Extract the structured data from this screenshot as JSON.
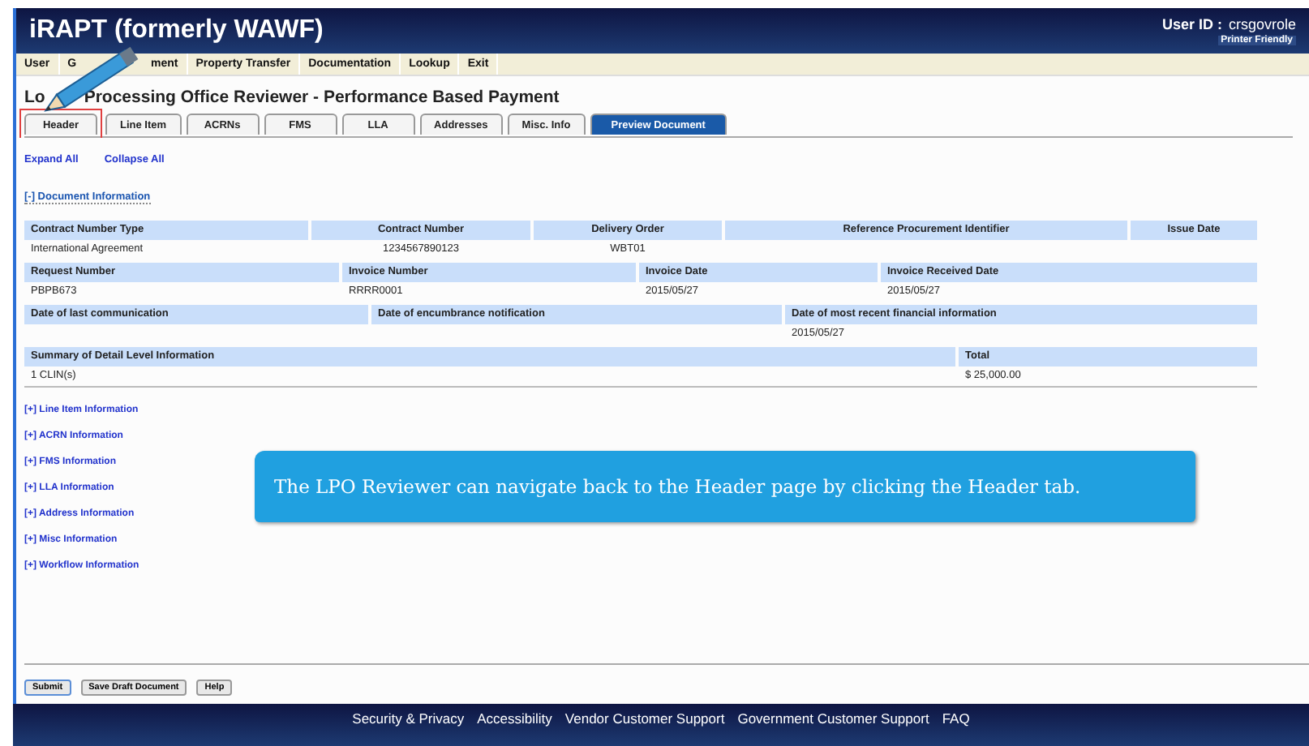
{
  "app": {
    "title": "iRAPT (formerly WAWF)",
    "user_label": "User ID :",
    "user_id": "crsgovrole",
    "printer_link": "Printer Friendly"
  },
  "menu": [
    {
      "parts": [
        "User"
      ]
    },
    {
      "parts": [
        "G",
        "ment"
      ]
    },
    {
      "parts": [
        "Property Transfer"
      ]
    },
    {
      "parts": [
        "Documentation"
      ]
    },
    {
      "parts": [
        "Lookup"
      ]
    },
    {
      "parts": [
        "Exit"
      ]
    }
  ],
  "page_title": [
    "Lo",
    "Processing Office Reviewer - Performance Based Payment"
  ],
  "tabs": [
    {
      "label": "Header",
      "selected": false,
      "highlighted": true
    },
    {
      "label": "Line Item",
      "selected": false,
      "highlighted": false
    },
    {
      "label": "ACRNs",
      "selected": false,
      "highlighted": false
    },
    {
      "label": "FMS",
      "selected": false,
      "highlighted": false
    },
    {
      "label": "LLA",
      "selected": false,
      "highlighted": false
    },
    {
      "label": "Addresses",
      "selected": false,
      "highlighted": false
    },
    {
      "label": "Misc. Info",
      "selected": false,
      "highlighted": false
    },
    {
      "label": "Preview Document",
      "selected": true,
      "highlighted": false
    }
  ],
  "expand_links": [
    "Expand All",
    "Collapse All"
  ],
  "document_section": "[-] Document Information",
  "info_rows": [
    {
      "columns": [
        {
          "label": "Contract Number Type",
          "value": "International Agreement"
        },
        {
          "label": "Contract Number",
          "value": "1234567890123"
        },
        {
          "label": "Delivery Order",
          "value": "WBT01"
        },
        {
          "label": "Reference Procurement Identifier"
        },
        {
          "label": "Issue Date"
        }
      ]
    },
    {
      "columns": [
        {
          "label": "Request Number",
          "value": "PBPB673"
        },
        {
          "label": "Invoice Number",
          "value": "RRRR0001"
        },
        {
          "label": "Invoice Date",
          "value": "2015/05/27"
        },
        {
          "label": "Invoice Received Date",
          "value": "2015/05/27"
        }
      ]
    },
    {
      "columns": [
        {
          "label": "Date of last communication"
        },
        {
          "label": "Date of encumbrance notification"
        },
        {
          "label": "Date of most recent financial information",
          "value": "2015/05/27"
        }
      ]
    },
    {
      "columns": [
        {
          "label": "Summary of Detail Level Information",
          "value": "1 CLIN(s)"
        },
        {
          "label": "Total",
          "value": "$ 25,000.00"
        }
      ]
    }
  ],
  "sections": [
    "[+] Line Item Information",
    "[+] ACRN Information",
    "[+] FMS Information",
    "[+] LLA Information",
    "[+] Address Information",
    "[+] Misc Information",
    "[+] Workflow Information"
  ],
  "callout": "The LPO Reviewer can navigate back to the Header page by clicking the Header tab.",
  "buttons": [
    "Submit",
    "Save Draft Document",
    "Help"
  ],
  "footer_links": [
    "Security & Privacy",
    "Accessibility",
    "Vendor Customer Support",
    "Government Customer Support",
    "FAQ"
  ]
}
